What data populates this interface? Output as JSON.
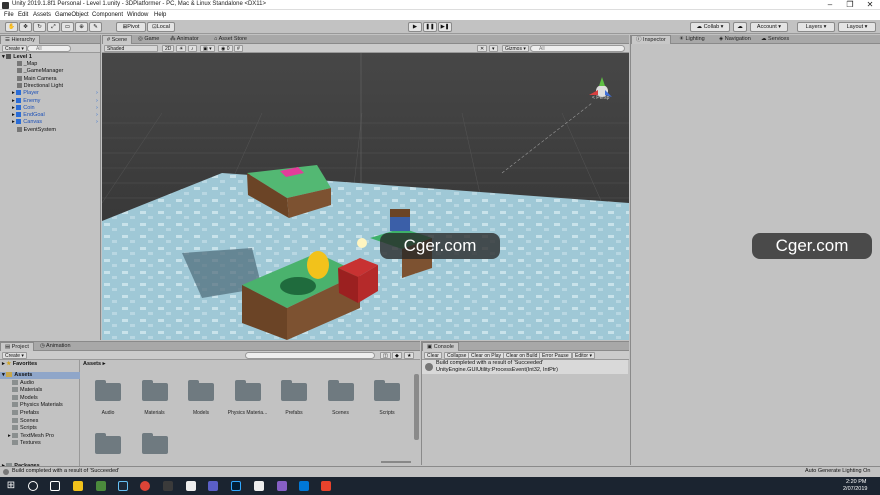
{
  "window": {
    "title": "Unity 2019.1.8f1 Personal - Level 1.unity - 3DPlatformer - PC, Mac & Linux Standalone <DX11>"
  },
  "menu": [
    "File",
    "Edit",
    "Assets",
    "GameObject",
    "Component",
    "Window",
    "Help"
  ],
  "toolbar": {
    "pivot": "Pivot",
    "local": "Local",
    "collab": "Collab",
    "account": "Account",
    "layers": "Layers",
    "layout": "Layout"
  },
  "hierarchy": {
    "tab": "Hierarchy",
    "create": "Create",
    "search_placeholder": "All",
    "scene": "Level 1",
    "items": [
      {
        "label": "_Map",
        "color": "#111111"
      },
      {
        "label": "_GameManager",
        "color": "#111111"
      },
      {
        "label": "Main Camera",
        "color": "#111111"
      },
      {
        "label": "Directional Light",
        "color": "#111111"
      },
      {
        "label": "Player",
        "color": "#1a4fb8"
      },
      {
        "label": "Enemy",
        "color": "#1a4fb8"
      },
      {
        "label": "Coin",
        "color": "#1a4fb8"
      },
      {
        "label": "EndGoal",
        "color": "#1a4fb8"
      },
      {
        "label": "Canvas",
        "color": "#1a4fb8"
      },
      {
        "label": "EventSystem",
        "color": "#111111"
      }
    ]
  },
  "scene_view": {
    "tabs": [
      "Scene",
      "Game",
      "Animator",
      "Asset Store"
    ],
    "shading": "Shaded",
    "mode2d": "2D",
    "gizmos": "Gizmos",
    "search_placeholder": "All",
    "persp": "< Persp"
  },
  "inspector": {
    "tabs": [
      "Inspector",
      "Lighting",
      "Navigation",
      "Services"
    ]
  },
  "project": {
    "tabs": [
      "Project",
      "Animation"
    ],
    "create": "Create",
    "favorites": "Favorites",
    "assets": "Assets",
    "tree": [
      "Audio",
      "Materials",
      "Models",
      "Physics Materials",
      "Prefabs",
      "Scenes",
      "Scripts",
      "TextMesh Pro",
      "Textures"
    ],
    "packages": "Packages",
    "breadcrumb": "Assets",
    "folders": [
      "Audio",
      "Materials",
      "Models",
      "Physics Materia...",
      "Prefabs",
      "Scenes",
      "Scripts"
    ]
  },
  "console": {
    "tab": "Console",
    "buttons": [
      "Clear",
      "Collapse",
      "Clear on Play",
      "Clear on Build",
      "Error Pause",
      "Editor"
    ],
    "line1": "Build completed with a result of 'Succeeded'",
    "line2": "UnityEngine.GUIUtility:ProcessEvent(Int32, IntPtr)"
  },
  "statusbar": {
    "message": "Build completed with a result of 'Succeeded'",
    "right": "Auto Generate Lighting On"
  },
  "taskbar": {
    "time": "2:20 PM",
    "date": "2/07/2019"
  },
  "watermarks": [
    "Cger.com",
    "Cger.com"
  ]
}
